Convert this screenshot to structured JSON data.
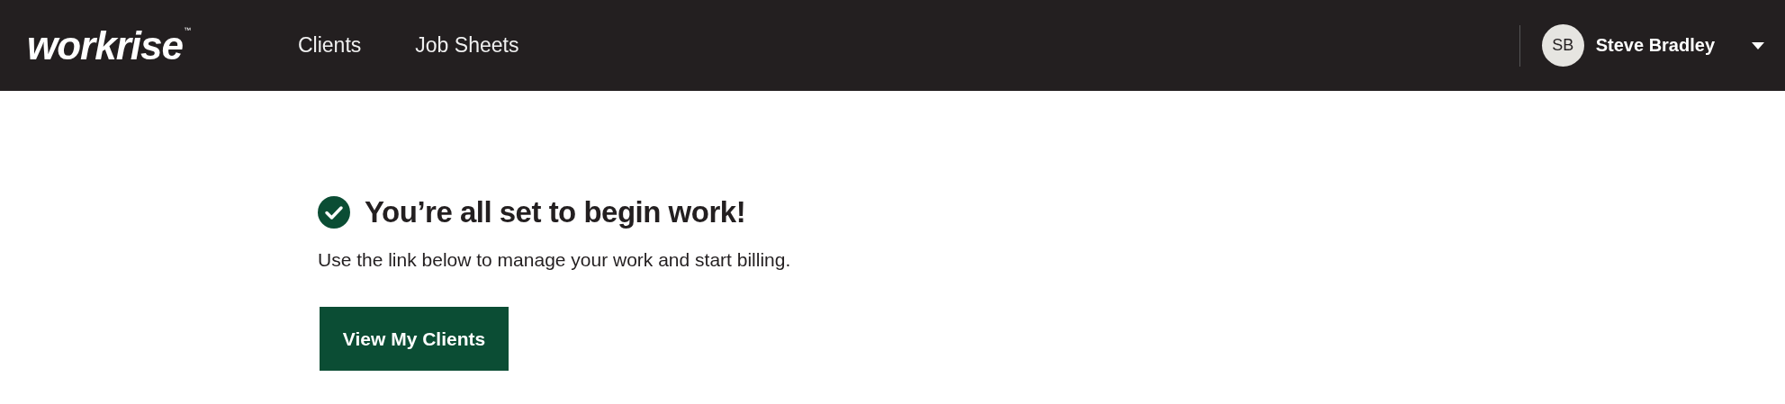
{
  "header": {
    "logo": "workrise",
    "logo_mark": "™",
    "nav": [
      "Clients",
      "Job Sheets"
    ],
    "user": {
      "initials": "SB",
      "name": "Steve Bradley"
    }
  },
  "main": {
    "heading": "You’re all set to begin work!",
    "text": "Use the link below to manage your work and start billing.",
    "button": "View My Clients"
  }
}
